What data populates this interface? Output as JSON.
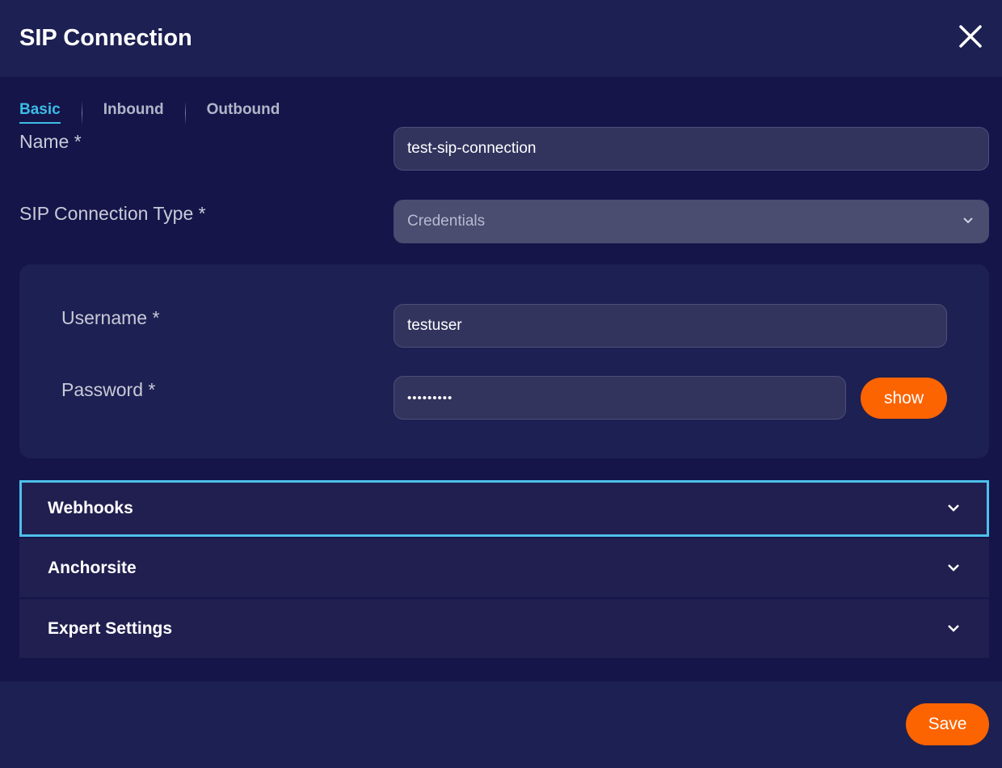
{
  "dialog": {
    "title": "SIP Connection",
    "close_icon": "close-icon"
  },
  "tabs": [
    {
      "label": "Basic",
      "active": true
    },
    {
      "label": "Inbound"
    },
    {
      "label": "Outbound"
    }
  ],
  "form": {
    "name_label": "Name *",
    "name_value": "test-sip-connection",
    "type_label": "SIP Connection Type *",
    "type_value": "Credentials",
    "username_label": "Username *",
    "username_value": "testuser",
    "password_label": "Password *",
    "password_value": "•••••••••",
    "show_label": "show"
  },
  "sections": [
    {
      "label": "Webhooks",
      "focused": true
    },
    {
      "label": "Anchorsite"
    },
    {
      "label": "Expert Settings"
    }
  ],
  "footer": {
    "save_label": "Save"
  },
  "colors": {
    "accent": "#3cbde6",
    "button": "#fb6400",
    "background": "#15154a",
    "panel": "#1d2052"
  }
}
